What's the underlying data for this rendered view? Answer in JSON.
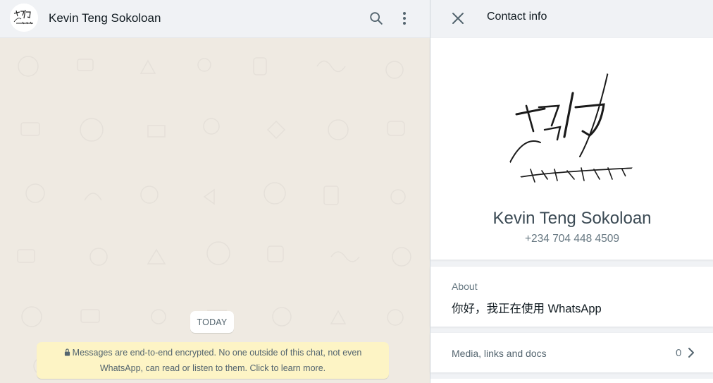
{
  "chat": {
    "contact_name": "Kevin Teng Sokoloan",
    "today_label": "TODAY",
    "encryption_notice": "Messages are end-to-end encrypted. No one outside of this chat, not even WhatsApp, can read or listen to them. Click to learn more."
  },
  "contact_info": {
    "title": "Contact info",
    "name": "Kevin Teng Sokoloan",
    "phone": "+234 704 448 4509",
    "about_label": "About",
    "about_text": "你好，我正在使用 WhatsApp",
    "media_label": "Media, links and docs",
    "media_count": "0"
  },
  "icons": {
    "search": "search-icon",
    "menu": "menu-dots-icon",
    "close": "close-icon",
    "lock": "lock-icon",
    "chevron": "chevron-right-icon"
  },
  "colors": {
    "chat_background": "#efeae2",
    "panel_header": "#f0f2f5",
    "notice_background": "#fdf4c5"
  }
}
